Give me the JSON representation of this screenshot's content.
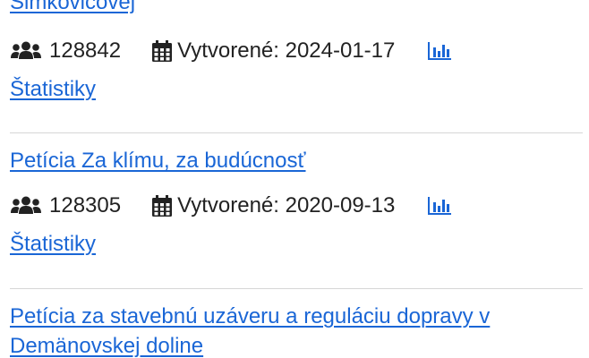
{
  "petitions": [
    {
      "title_partial": "Šimkovičovej",
      "signatures": "128842",
      "created": "Vytvorené: 2024-01-17",
      "stats_label": "Štatistiky"
    },
    {
      "title": "Petícia Za klímu, za budúcnosť",
      "signatures": "128305",
      "created": "Vytvorené: 2020-09-13",
      "stats_label": "Štatistiky"
    },
    {
      "title_line1": "Petícia za stavebnú uzáveru a reguláciu dopravy v",
      "title_line2": "Demänovskej doline"
    }
  ],
  "icons": {
    "signatures": "users-icon",
    "created": "calendar-icon",
    "stats": "bar-chart-icon"
  },
  "colors": {
    "link": "#1a66d6",
    "text": "#222222",
    "divider": "#d6d6d6"
  }
}
